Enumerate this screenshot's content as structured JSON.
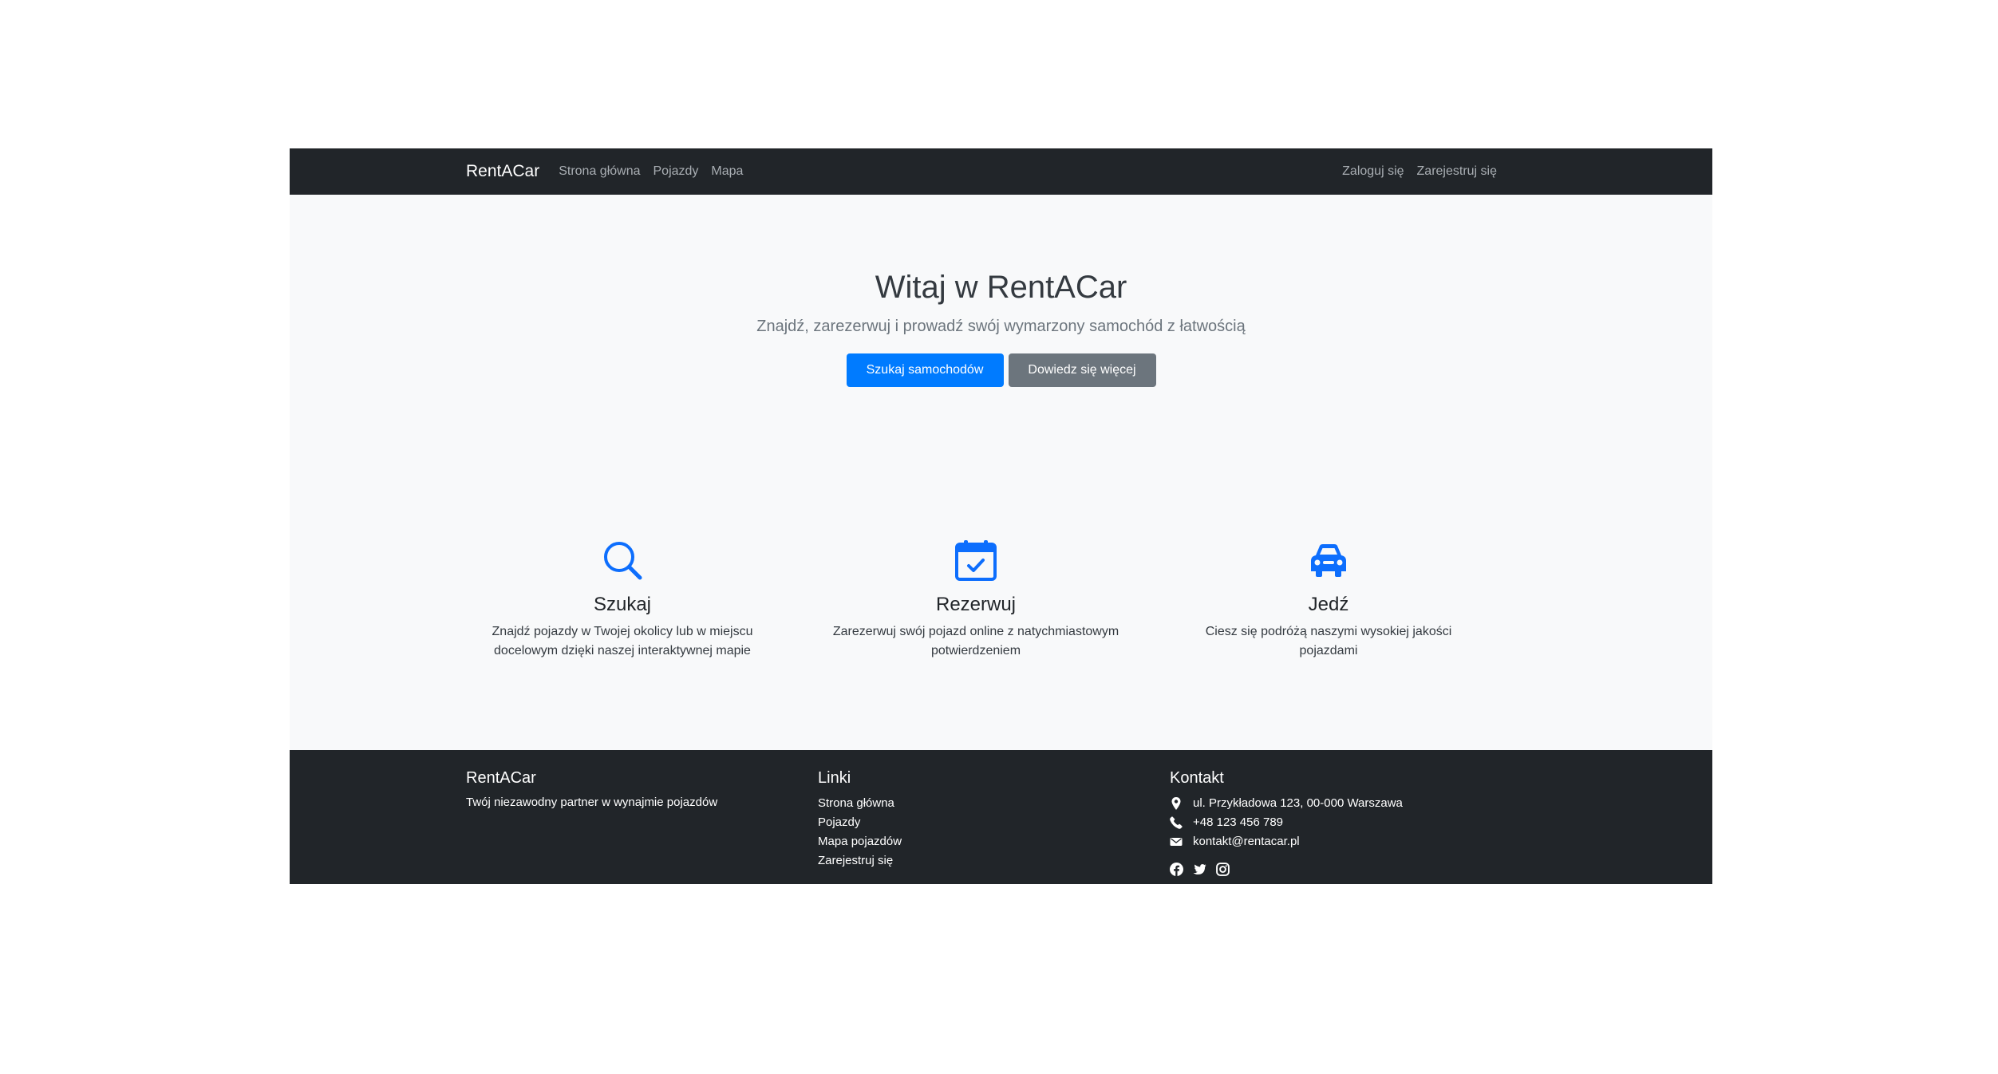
{
  "navbar": {
    "brand": "RentACar",
    "links": [
      "Strona główna",
      "Pojazdy",
      "Mapa"
    ],
    "auth": {
      "login": "Zaloguj się",
      "register": "Zarejestruj się"
    }
  },
  "hero": {
    "title": "Witaj w RentACar",
    "subtitle": "Znajdź, zarezerwuj i prowadź swój wymarzony samochód z łatwością",
    "primary_button": "Szukaj samochodów",
    "secondary_button": "Dowiedz się więcej"
  },
  "features": [
    {
      "icon": "search-icon",
      "title": "Szukaj",
      "text_line1": "Znajdź pojazdy w Twojej okolicy lub w miejscu",
      "text_line2": "docelowym dzięki naszej interaktywnej mapie"
    },
    {
      "icon": "calendar-check-icon",
      "title": "Rezerwuj",
      "text_line1": "Zarezerwuj swój pojazd online z natychmiastowym",
      "text_line2": "potwierdzeniem"
    },
    {
      "icon": "car-icon",
      "title": "Jedź",
      "text_line1": "Ciesz się podróżą naszymi wysokiej jakości",
      "text_line2": "pojazdami"
    }
  ],
  "footer": {
    "about": {
      "title": "RentACar",
      "text": "Twój niezawodny partner w wynajmie pojazdów"
    },
    "links": {
      "title": "Linki",
      "items": [
        "Strona główna",
        "Pojazdy",
        "Mapa pojazdów",
        "Zarejestruj się"
      ]
    },
    "contact": {
      "title": "Kontakt",
      "address": "ul. Przykładowa 123, 00-000 Warszawa",
      "phone": "+48 123 456 789",
      "email": "kontakt@rentacar.pl",
      "socials": [
        "facebook-icon",
        "twitter-icon",
        "instagram-icon"
      ]
    }
  },
  "colors": {
    "navbar_bg": "#212529",
    "primary": "#007bff",
    "secondary": "#6c757d",
    "icon_blue": "#0d6efd",
    "page_bg": "#f8f9fa"
  }
}
